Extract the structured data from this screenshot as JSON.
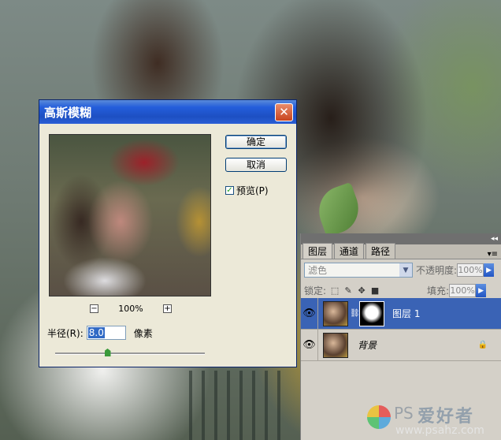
{
  "dialog": {
    "title": "高斯模糊",
    "close_glyph": "✕",
    "ok_label": "确定",
    "cancel_label": "取消",
    "preview_checkbox": {
      "label": "预览(P)",
      "checked": true
    },
    "zoom": {
      "minus": "−",
      "value": "100%",
      "plus": "+"
    },
    "radius": {
      "label": "半径(R):",
      "value": "8.0",
      "unit": "像素"
    },
    "slider_level_fraction": 0.35
  },
  "layers_panel": {
    "collapse_glyph": "◂◂",
    "tabs": [
      {
        "label": "图层",
        "active": true
      },
      {
        "label": "通道",
        "active": false
      },
      {
        "label": "路径",
        "active": false
      }
    ],
    "menu_glyph": "▾≡",
    "blend_mode": "滤色",
    "opacity_label": "不透明度:",
    "opacity_value": "100%",
    "lock_label": "锁定:",
    "fill_label": "填充:",
    "fill_value": "100%",
    "layers": [
      {
        "name": "图层 1",
        "selected": true,
        "visible": true,
        "has_mask": true
      },
      {
        "name": "背景",
        "selected": false,
        "visible": true,
        "locked": true
      }
    ]
  },
  "watermark": {
    "prefix": "PS",
    "brand": "爱好者",
    "url": "www.psahz.com"
  },
  "colors": {
    "title_bar": "#245edb",
    "selected_layer": "#3a63b5",
    "dialog_bg": "#ece9d8",
    "panel_bg": "#d4d0c8"
  }
}
